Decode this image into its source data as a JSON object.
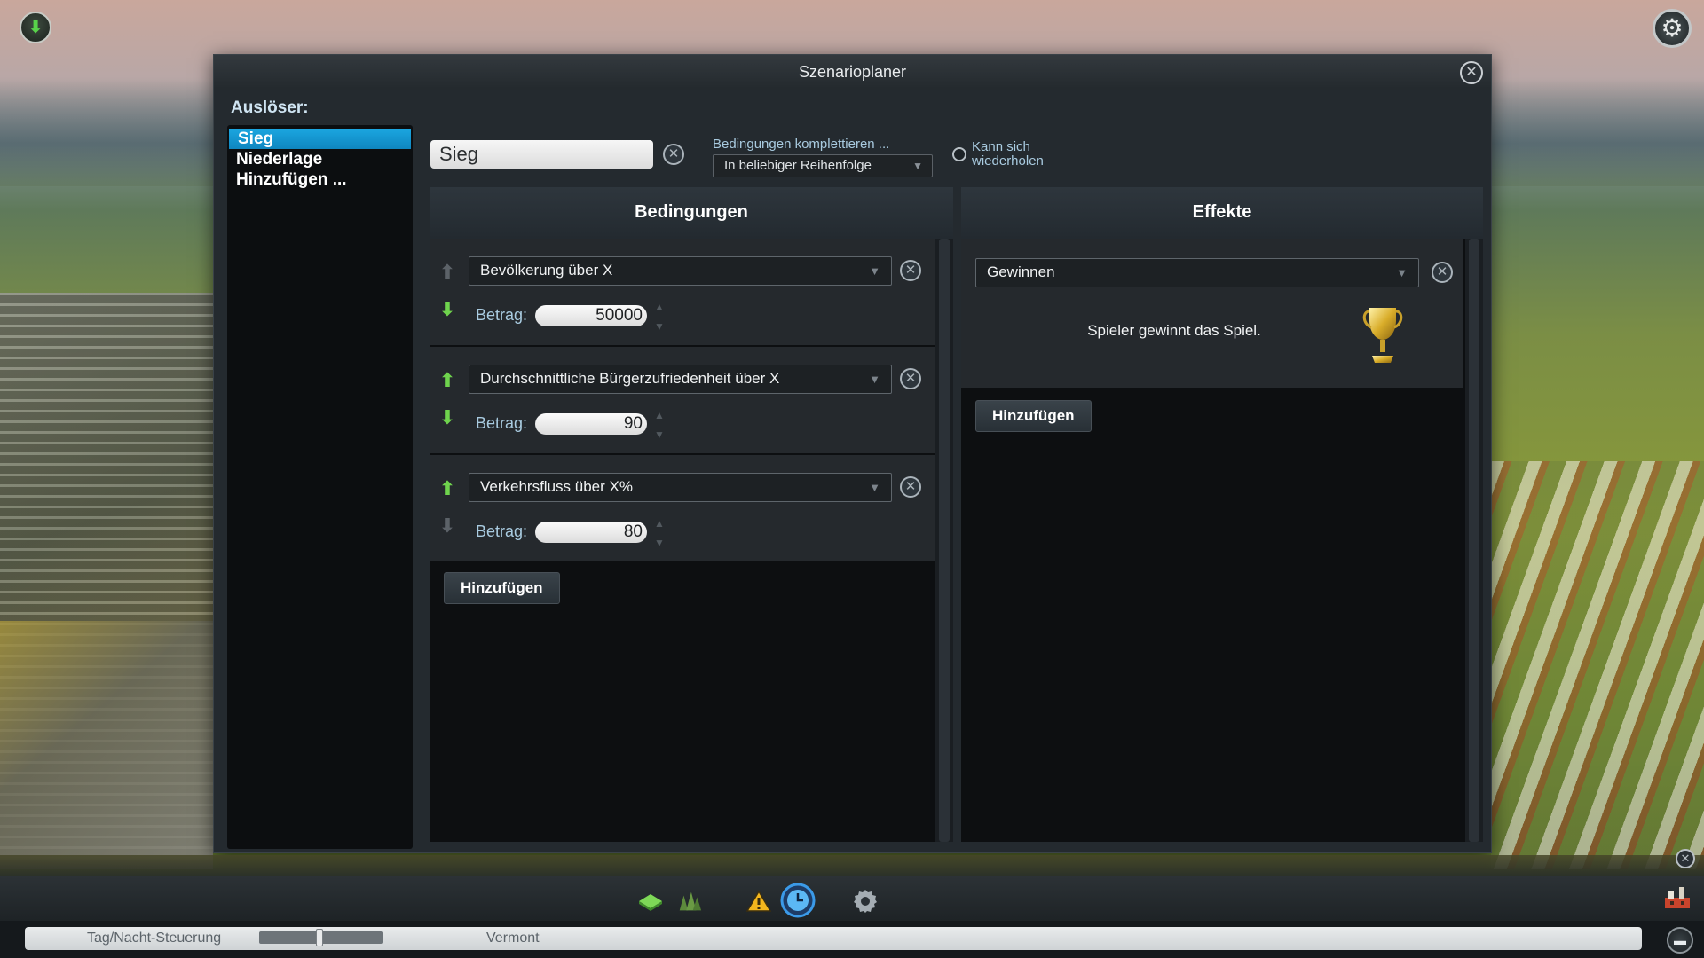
{
  "window": {
    "title": "Szenarioplaner"
  },
  "triggers": {
    "label": "Auslöser:",
    "items": [
      "Sieg",
      "Niederlage",
      "Hinzufügen ..."
    ],
    "selected": "Sieg"
  },
  "trigger_settings": {
    "name_value": "Sieg",
    "complete_label": "Bedingungen komplettieren ...",
    "order_value": "In beliebiger Reihenfolge",
    "repeat_label": "Kann sich wiederholen",
    "repeat_checked": false
  },
  "conditions": {
    "header": "Bedingungen",
    "amount_label": "Betrag:",
    "items": [
      {
        "type": "Bevölkerung über X",
        "amount": "50000",
        "can_move_up": false,
        "can_move_down": true
      },
      {
        "type": "Durchschnittliche Bürgerzufriedenheit über X",
        "amount": "90",
        "can_move_up": true,
        "can_move_down": true
      },
      {
        "type": "Verkehrsfluss über X%",
        "amount": "80",
        "can_move_up": true,
        "can_move_down": false
      }
    ],
    "add_label": "Hinzufügen"
  },
  "effects": {
    "header": "Effekte",
    "items": [
      {
        "type": "Gewinnen",
        "description": "Spieler gewinnt das Spiel.",
        "icon": "trophy-icon"
      }
    ],
    "add_label": "Hinzufügen"
  },
  "status_bar": {
    "day_night_label": "Tag/Nacht-Steuerung",
    "day_night_value": 0.47,
    "map_name": "Vermont"
  },
  "toolbar": {
    "icons": [
      "terrain-icon",
      "trees-icon",
      "disaster-warning-icon",
      "clock-icon",
      "settings-cog-icon"
    ]
  },
  "colors": {
    "accent": "#1ba6e0",
    "window_bg": "#242a2f",
    "panel_bg": "#0d0f11",
    "label_blue": "#a9cbe0",
    "arrow_green": "#6fd34d"
  }
}
